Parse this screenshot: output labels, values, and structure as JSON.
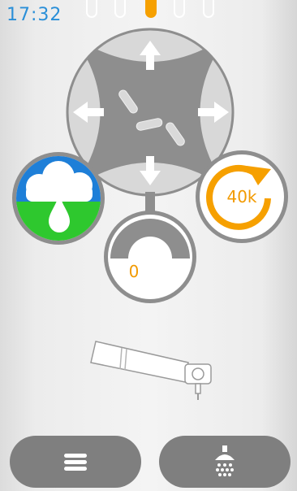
{
  "status": {
    "time": "17:32"
  },
  "pager": {
    "count": 5,
    "active_index": 2
  },
  "controls": {
    "speed_label": "40k",
    "gauge_value": "0"
  },
  "toolbar": {
    "menu_icon": "hamburger-menu-icon",
    "spray_icon": "water-spray-icon"
  },
  "colors": {
    "accent_orange": "#f6a000",
    "time_blue": "#2a8fd8",
    "control_gray": "#8d8d8d",
    "sky_blue": "#1e7fd8",
    "grass_green": "#2ec82e"
  }
}
